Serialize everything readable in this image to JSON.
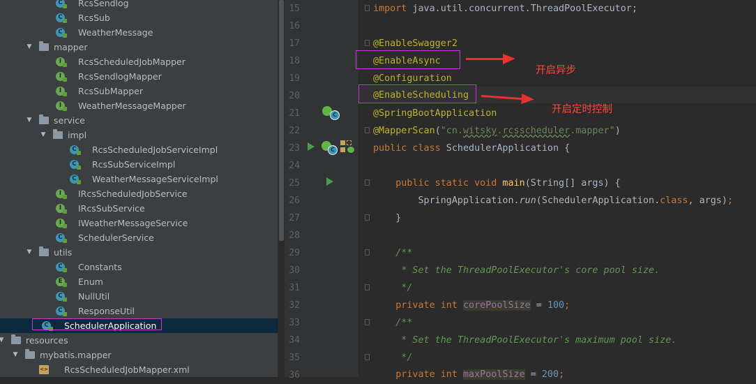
{
  "tree": {
    "rows": [
      {
        "label": "RcsSendlog",
        "icon": "class",
        "indent": 80,
        "arrow": ""
      },
      {
        "label": "RcsSub",
        "icon": "class",
        "indent": 80,
        "arrow": ""
      },
      {
        "label": "WeatherMessage",
        "icon": "class",
        "indent": 80,
        "arrow": ""
      },
      {
        "label": "mapper",
        "icon": "folder",
        "indent": 60,
        "arrow": "▼"
      },
      {
        "label": "RcsScheduledJobMapper",
        "icon": "interface",
        "indent": 80,
        "arrow": ""
      },
      {
        "label": "RcsSendlogMapper",
        "icon": "interface",
        "indent": 80,
        "arrow": ""
      },
      {
        "label": "RcsSubMapper",
        "icon": "interface",
        "indent": 80,
        "arrow": ""
      },
      {
        "label": "WeatherMessageMapper",
        "icon": "interface",
        "indent": 80,
        "arrow": ""
      },
      {
        "label": "service",
        "icon": "folder",
        "indent": 60,
        "arrow": "▼"
      },
      {
        "label": "impl",
        "icon": "folder",
        "indent": 80,
        "arrow": "▼"
      },
      {
        "label": "RcsScheduledJobServiceImpl",
        "icon": "class",
        "indent": 100,
        "arrow": ""
      },
      {
        "label": "RcsSubServiceImpl",
        "icon": "class",
        "indent": 100,
        "arrow": ""
      },
      {
        "label": "WeatherMessageServiceImpl",
        "icon": "class",
        "indent": 100,
        "arrow": ""
      },
      {
        "label": "IRcsScheduledJobService",
        "icon": "interface",
        "indent": 80,
        "arrow": ""
      },
      {
        "label": "IRcsSubService",
        "icon": "interface",
        "indent": 80,
        "arrow": ""
      },
      {
        "label": "IWeatherMessageService",
        "icon": "interface",
        "indent": 80,
        "arrow": ""
      },
      {
        "label": "SchedulerService",
        "icon": "class",
        "indent": 80,
        "arrow": ""
      },
      {
        "label": "utils",
        "icon": "folder",
        "indent": 60,
        "arrow": "▼"
      },
      {
        "label": "Constants",
        "icon": "class",
        "indent": 80,
        "arrow": ""
      },
      {
        "label": "Enum",
        "icon": "enum",
        "indent": 80,
        "arrow": ""
      },
      {
        "label": "NullUtil",
        "icon": "class",
        "indent": 80,
        "arrow": ""
      },
      {
        "label": "ResponseUtil",
        "icon": "class",
        "indent": 80,
        "arrow": ""
      },
      {
        "label": "SchedulerApplication",
        "icon": "spring-class",
        "indent": 60,
        "arrow": "",
        "selected": true
      },
      {
        "label": "resources",
        "icon": "folder",
        "indent": 20,
        "arrow": "▼"
      },
      {
        "label": "mybatis.mapper",
        "icon": "folder",
        "indent": 40,
        "arrow": "▼"
      },
      {
        "label": "RcsScheduledJobMapper.xml",
        "icon": "xml",
        "indent": 60,
        "arrow": ""
      }
    ]
  },
  "editor": {
    "line_numbers": [
      "15",
      "16",
      "17",
      "18",
      "19",
      "20",
      "21",
      "22",
      "23",
      "24",
      "25",
      "26",
      "27",
      "28",
      "29",
      "30",
      "31",
      "32",
      "33",
      "34",
      "35",
      "36"
    ],
    "lines": {
      "l15_kw": "import",
      "l15_rest": " java.util.concurrent.ThreadPoolExecutor;",
      "l17": "@EnableSwagger2",
      "l18": "@EnableAsync",
      "l19": "@Configuration",
      "l20": "@EnableScheduling",
      "l21": "@SpringBootApplication",
      "l22_an": "@MapperScan",
      "l22_p1": "(",
      "l22_str1": "\"cn.",
      "l22_sq1": "witsky",
      "l22_str2": ".",
      "l22_sq2": "rcsscheduler",
      "l22_str3": ".mapper\"",
      "l22_p2": ")",
      "l23_kw": "public class",
      "l23_rest": " SchedulerApplication {",
      "l25_kw": "    public static void",
      "l25_fn": " main",
      "l25_rest": "(String[] args) {",
      "l26_a": "        SpringApplication.",
      "l26_it": "run",
      "l26_b": "(SchedulerApplication.",
      "l26_kw": "class",
      "l26_c": ", args)",
      "l26_semi": ";",
      "l27": "    }",
      "l29": "    /**",
      "l30": "     * Set the ThreadPoolExecutor's core pool size.",
      "l31": "     */",
      "l32_kw": "    private int",
      "l32_field": "corePoolSize",
      "l32_eq": " = ",
      "l32_num": "100",
      "l32_semi": ";",
      "l33": "    /**",
      "l34": "     * Set the ThreadPoolExecutor's maximum pool size.",
      "l35": "     */",
      "l36_kw": "    private int",
      "l36_field": "maxPoolSize",
      "l36_eq": " = ",
      "l36_num": "200",
      "l36_semi": ";"
    }
  },
  "annotations": {
    "async_note": "开启异步",
    "scheduling_note": "开启定时控制",
    "color": "#e8322f",
    "box_color": "#c43cd8"
  }
}
